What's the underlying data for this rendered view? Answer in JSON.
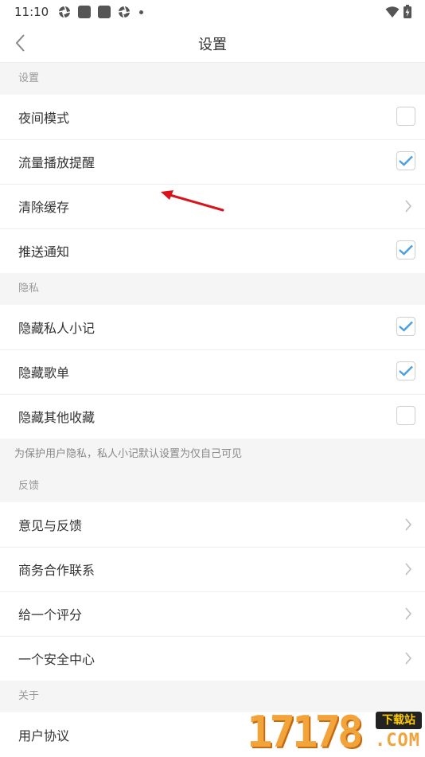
{
  "status_bar": {
    "time": "11:10",
    "left_icons": [
      "aperture-icon",
      "app-square-icon",
      "app-square-icon",
      "aperture-icon",
      "dot-icon"
    ],
    "right_icons": [
      "wifi-icon",
      "battery-charging-icon"
    ]
  },
  "nav": {
    "title": "设置",
    "back_icon": "chevron-left-icon"
  },
  "sections": [
    {
      "header": "设置",
      "rows": [
        {
          "label": "夜间模式",
          "control": "checkbox",
          "checked": false
        },
        {
          "label": "流量播放提醒",
          "control": "checkbox",
          "checked": true
        },
        {
          "label": "清除缓存",
          "control": "chevron"
        },
        {
          "label": "推送通知",
          "control": "checkbox",
          "checked": true
        }
      ]
    },
    {
      "header": "隐私",
      "rows": [
        {
          "label": "隐藏私人小记",
          "control": "checkbox",
          "checked": true
        },
        {
          "label": "隐藏歌单",
          "control": "checkbox",
          "checked": true
        },
        {
          "label": "隐藏其他收藏",
          "control": "checkbox",
          "checked": false
        }
      ],
      "note": "为保护用户隐私，私人小记默认设置为仅自己可见"
    },
    {
      "header": "反馈",
      "rows": [
        {
          "label": "意见与反馈",
          "control": "chevron"
        },
        {
          "label": "商务合作联系",
          "control": "chevron"
        },
        {
          "label": "给一个评分",
          "control": "chevron"
        },
        {
          "label": "一个安全中心",
          "control": "chevron"
        }
      ]
    },
    {
      "header": "关于",
      "rows": [
        {
          "label": "用户协议",
          "control": "chevron"
        }
      ]
    }
  ],
  "watermark": {
    "digits": "17178",
    "badge": "下载站",
    "domain": ".COM"
  },
  "colors": {
    "accent_check": "#4a9fe0",
    "annotation_arrow": "#d9121b",
    "background": "#f5f5f5"
  }
}
